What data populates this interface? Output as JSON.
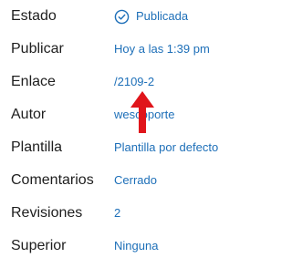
{
  "colors": {
    "label": "#1e1e1e",
    "link": "#1d6fb8",
    "arrow": "#e0151b"
  },
  "status_icon": "check-circle-icon",
  "rows": [
    {
      "label": "Estado",
      "value": "Publicada"
    },
    {
      "label": "Publicar",
      "value": "Hoy a las 1:39 pm"
    },
    {
      "label": "Enlace",
      "value": "/2109-2"
    },
    {
      "label": "Autor",
      "value": "wescoporte"
    },
    {
      "label": "Plantilla",
      "value": "Plantilla por defecto"
    },
    {
      "label": "Comentarios",
      "value": "Cerrado"
    },
    {
      "label": "Revisiones",
      "value": "2"
    },
    {
      "label": "Superior",
      "value": "Ninguna"
    }
  ]
}
